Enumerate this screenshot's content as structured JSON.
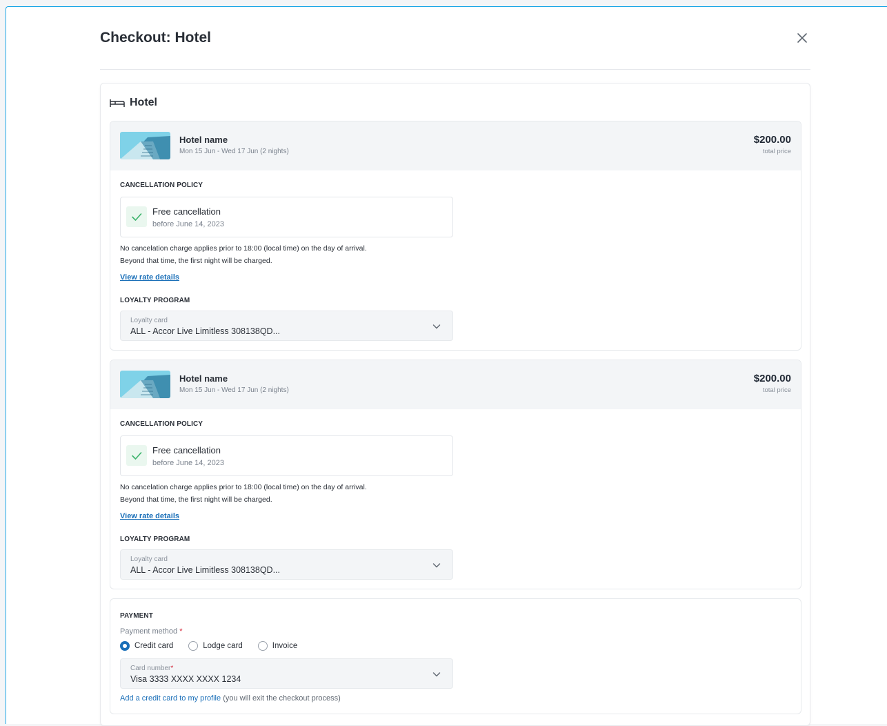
{
  "modal": {
    "title": "Checkout: Hotel"
  },
  "section": {
    "title": "Hotel"
  },
  "bookings": [
    {
      "hotel_name": "Hotel name",
      "dates": "Mon 15 Jun - Wed 17 Jun (2 nights)",
      "price": "$200.00",
      "price_label": "total price",
      "cancellation_heading": "CANCELLATION POLICY",
      "cancellation_title": "Free cancellation",
      "cancellation_sub": "before June 14, 2023",
      "policy_line1": "No cancelation charge applies prior to 18:00 (local time) on the day of arrival.",
      "policy_line2": "Beyond that time, the first night will be charged.",
      "rate_link": "View rate details",
      "loyalty_heading": "LOYALTY PROGRAM",
      "loyalty_label": "Loyalty card",
      "loyalty_value": "ALL - Accor Live Limitless 308138QD..."
    },
    {
      "hotel_name": "Hotel name",
      "dates": "Mon 15 Jun - Wed 17 Jun (2 nights)",
      "price": "$200.00",
      "price_label": "total price",
      "cancellation_heading": "CANCELLATION POLICY",
      "cancellation_title": "Free cancellation",
      "cancellation_sub": "before June 14, 2023",
      "policy_line1": "No cancelation charge applies prior to 18:00 (local time) on the day of arrival.",
      "policy_line2": "Beyond that time, the first night will be charged.",
      "rate_link": "View rate details",
      "loyalty_heading": "LOYALTY PROGRAM",
      "loyalty_label": "Loyalty card",
      "loyalty_value": "ALL - Accor Live Limitless 308138QD..."
    }
  ],
  "payment": {
    "heading": "PAYMENT",
    "method_label": "Payment method",
    "required_mark": "*",
    "options": [
      "Credit card",
      "Lodge card",
      "Invoice"
    ],
    "selected": "Credit card",
    "card_label": "Card number",
    "card_value": "Visa 3333 XXXX XXXX 1234",
    "add_card_link": "Add a credit card to my profile",
    "add_card_note": "(you will exit the checkout process)"
  },
  "icons": {
    "close": "close-icon",
    "section": "bed-icon",
    "check": "check-icon",
    "chevron": "chevron-down-icon"
  },
  "colors": {
    "accent": "#1a6fb8",
    "frame_border": "#1aa6e6",
    "success": "#3bb36b",
    "required": "#d6283a"
  }
}
